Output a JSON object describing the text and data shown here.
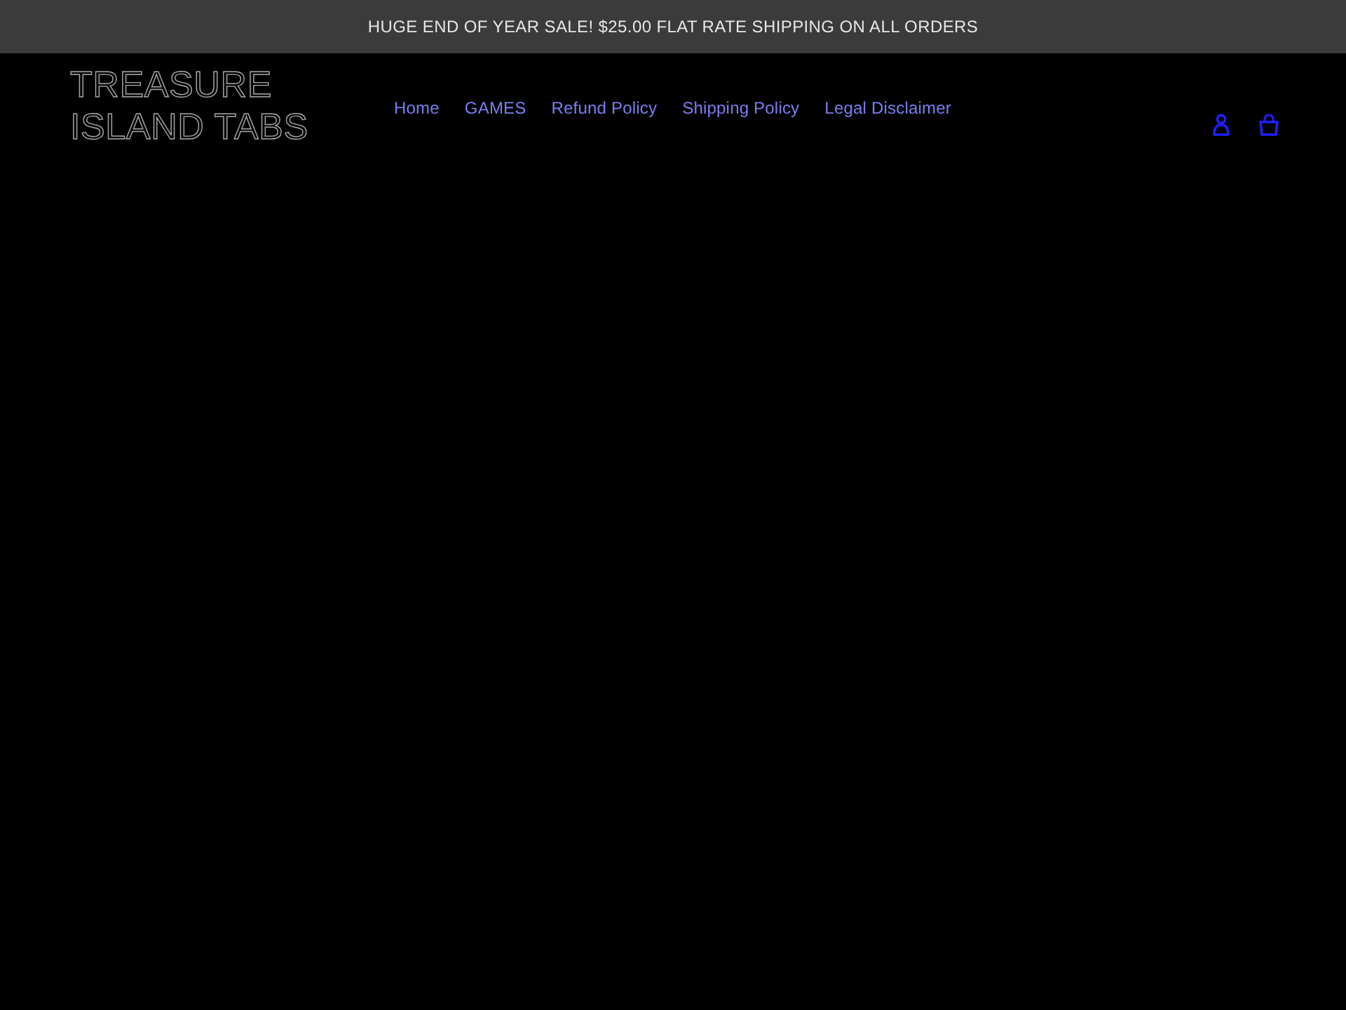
{
  "announcement": {
    "text": "HUGE END OF YEAR SALE! $25.00 FLAT RATE SHIPPING ON ALL ORDERS"
  },
  "header": {
    "logo_lines": [
      "TREASURE",
      "ISLAND TABS"
    ],
    "nav": [
      {
        "label": "Home"
      },
      {
        "label": "GAMES"
      },
      {
        "label": "Refund Policy"
      },
      {
        "label": "Shipping Policy"
      },
      {
        "label": "Legal Disclaimer"
      }
    ]
  }
}
